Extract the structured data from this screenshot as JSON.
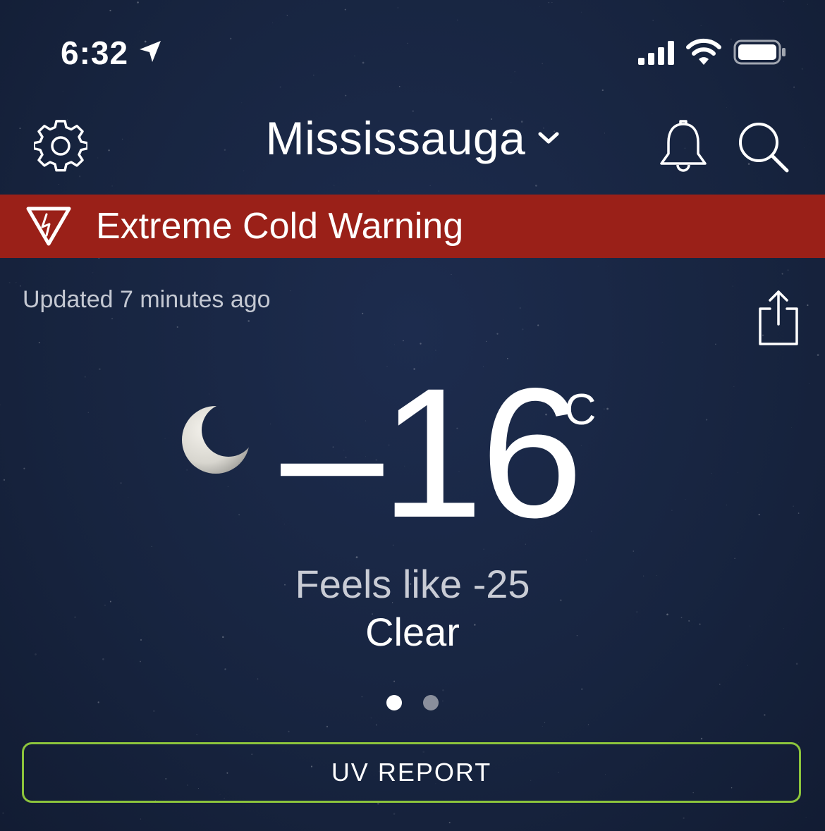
{
  "status_bar": {
    "time": "6:32"
  },
  "header": {
    "city": "Mississauga"
  },
  "alert": {
    "text": "Extreme Cold Warning",
    "color": "#9a2018"
  },
  "updated_text": "Updated 7 minutes ago",
  "current": {
    "temperature": "-16",
    "unit": "°C",
    "feels_like": "Feels like -25",
    "condition": "Clear",
    "icon": "crescent-moon-icon"
  },
  "pager": {
    "count": 2,
    "active_index": 0
  },
  "uv_button": {
    "label": "UV REPORT",
    "border_color": "#8cc43c"
  }
}
